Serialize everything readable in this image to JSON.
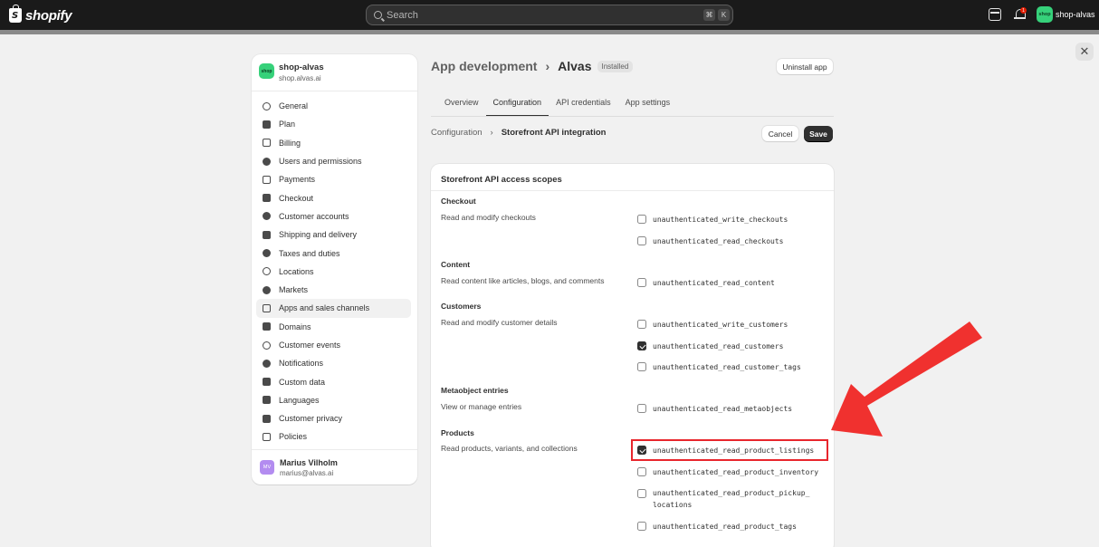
{
  "topbar": {
    "logo_text": "shopify",
    "search_placeholder": "Search",
    "kbd_1": "⌘",
    "kbd_2": "K",
    "notification_count": "1",
    "store_chip_initials": "shop",
    "store_chip_label": "shop-alvas"
  },
  "modal": {
    "close_label": "✕"
  },
  "sidebar": {
    "store_name": "shop-alvas",
    "store_domain": "shop.alvas.ai",
    "store_initials": "shop",
    "items": [
      {
        "label": "General",
        "icon": "gear-icon"
      },
      {
        "label": "Plan",
        "icon": "chart-icon"
      },
      {
        "label": "Billing",
        "icon": "billing-icon"
      },
      {
        "label": "Users and permissions",
        "icon": "users-icon"
      },
      {
        "label": "Payments",
        "icon": "payments-icon"
      },
      {
        "label": "Checkout",
        "icon": "cart-icon"
      },
      {
        "label": "Customer accounts",
        "icon": "person-icon"
      },
      {
        "label": "Shipping and delivery",
        "icon": "truck-icon"
      },
      {
        "label": "Taxes and duties",
        "icon": "taxes-icon"
      },
      {
        "label": "Locations",
        "icon": "location-icon"
      },
      {
        "label": "Markets",
        "icon": "globe-icon"
      },
      {
        "label": "Apps and sales channels",
        "icon": "apps-icon"
      },
      {
        "label": "Domains",
        "icon": "domains-icon"
      },
      {
        "label": "Customer events",
        "icon": "events-icon"
      },
      {
        "label": "Notifications",
        "icon": "bell-icon"
      },
      {
        "label": "Custom data",
        "icon": "database-icon"
      },
      {
        "label": "Languages",
        "icon": "language-icon"
      },
      {
        "label": "Customer privacy",
        "icon": "lock-icon"
      },
      {
        "label": "Policies",
        "icon": "policy-icon"
      }
    ],
    "active_item": "Apps and sales channels",
    "user_initials": "MV",
    "user_name": "Marius Vilholm",
    "user_email": "marius@alvas.ai"
  },
  "header": {
    "section": "App development",
    "separator": "›",
    "app_name": "Alvas",
    "status_badge": "Installed",
    "uninstall_label": "Uninstall app"
  },
  "tabs": [
    "Overview",
    "Configuration",
    "API credentials",
    "App settings"
  ],
  "active_tab": "Configuration",
  "breadcrumb": {
    "parent": "Configuration",
    "chevron": "›",
    "current": "Storefront API integration",
    "cancel_label": "Cancel",
    "save_label": "Save"
  },
  "card": {
    "title": "Storefront API access scopes",
    "sections": [
      {
        "title": "Checkout",
        "desc": "Read and modify checkouts",
        "scopes": [
          {
            "name": "unauthenticated_write_checkouts",
            "checked": false
          },
          {
            "name": "unauthenticated_read_checkouts",
            "checked": false
          }
        ]
      },
      {
        "title": "Content",
        "desc": "Read content like articles, blogs, and comments",
        "scopes": [
          {
            "name": "unauthenticated_read_content",
            "checked": false
          }
        ]
      },
      {
        "title": "Customers",
        "desc": "Read and modify customer details",
        "scopes": [
          {
            "name": "unauthenticated_write_customers",
            "checked": false
          },
          {
            "name": "unauthenticated_read_customers",
            "checked": true
          },
          {
            "name": "unauthenticated_read_customer_tags",
            "checked": false
          }
        ]
      },
      {
        "title": "Metaobject entries",
        "desc": "View or manage entries",
        "scopes": [
          {
            "name": "unauthenticated_read_metaobjects",
            "checked": false
          }
        ]
      },
      {
        "title": "Products",
        "desc": "Read products, variants, and collections",
        "scopes": [
          {
            "name": "unauthenticated_read_product_listings",
            "checked": true
          },
          {
            "name": "unauthenticated_read_product_inventory",
            "checked": false
          },
          {
            "name": "unauthenticated_read_product_pickup_",
            "name_line2": "locations",
            "checked": false
          },
          {
            "name": "unauthenticated_read_product_tags",
            "checked": false
          }
        ]
      }
    ]
  },
  "annotation": {
    "color": "#e8262d",
    "highlighted_scope": "unauthenticated_read_product_listings"
  }
}
